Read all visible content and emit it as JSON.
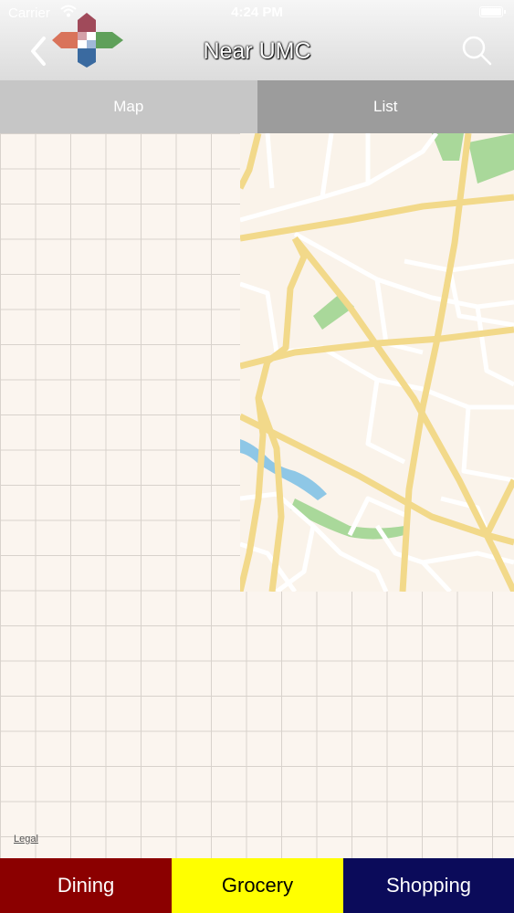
{
  "status_bar": {
    "carrier": "Carrier",
    "time": "4:24 PM"
  },
  "nav": {
    "title": "Near UMC",
    "back_icon": "chevron-left-icon",
    "search_icon": "search-icon"
  },
  "tabs": [
    {
      "label": "Map"
    },
    {
      "label": "List"
    }
  ],
  "map": {
    "legal": "Legal"
  },
  "categories": [
    {
      "label": "Dining",
      "bg": "#8b0000",
      "fg": "#ffffff"
    },
    {
      "label": "Grocery",
      "bg": "#ffff00",
      "fg": "#000000"
    },
    {
      "label": "Shopping",
      "bg": "#0b0b5a",
      "fg": "#ffffff"
    }
  ],
  "colors": {
    "logo_top": "#a04a5a",
    "logo_left": "#d9735a",
    "logo_right": "#5fa05a",
    "logo_bottom": "#3a6aa0",
    "road_major": "#f2d98a",
    "road_minor": "#ffffff",
    "park": "#a9d89a",
    "water": "#8ec7e6"
  }
}
